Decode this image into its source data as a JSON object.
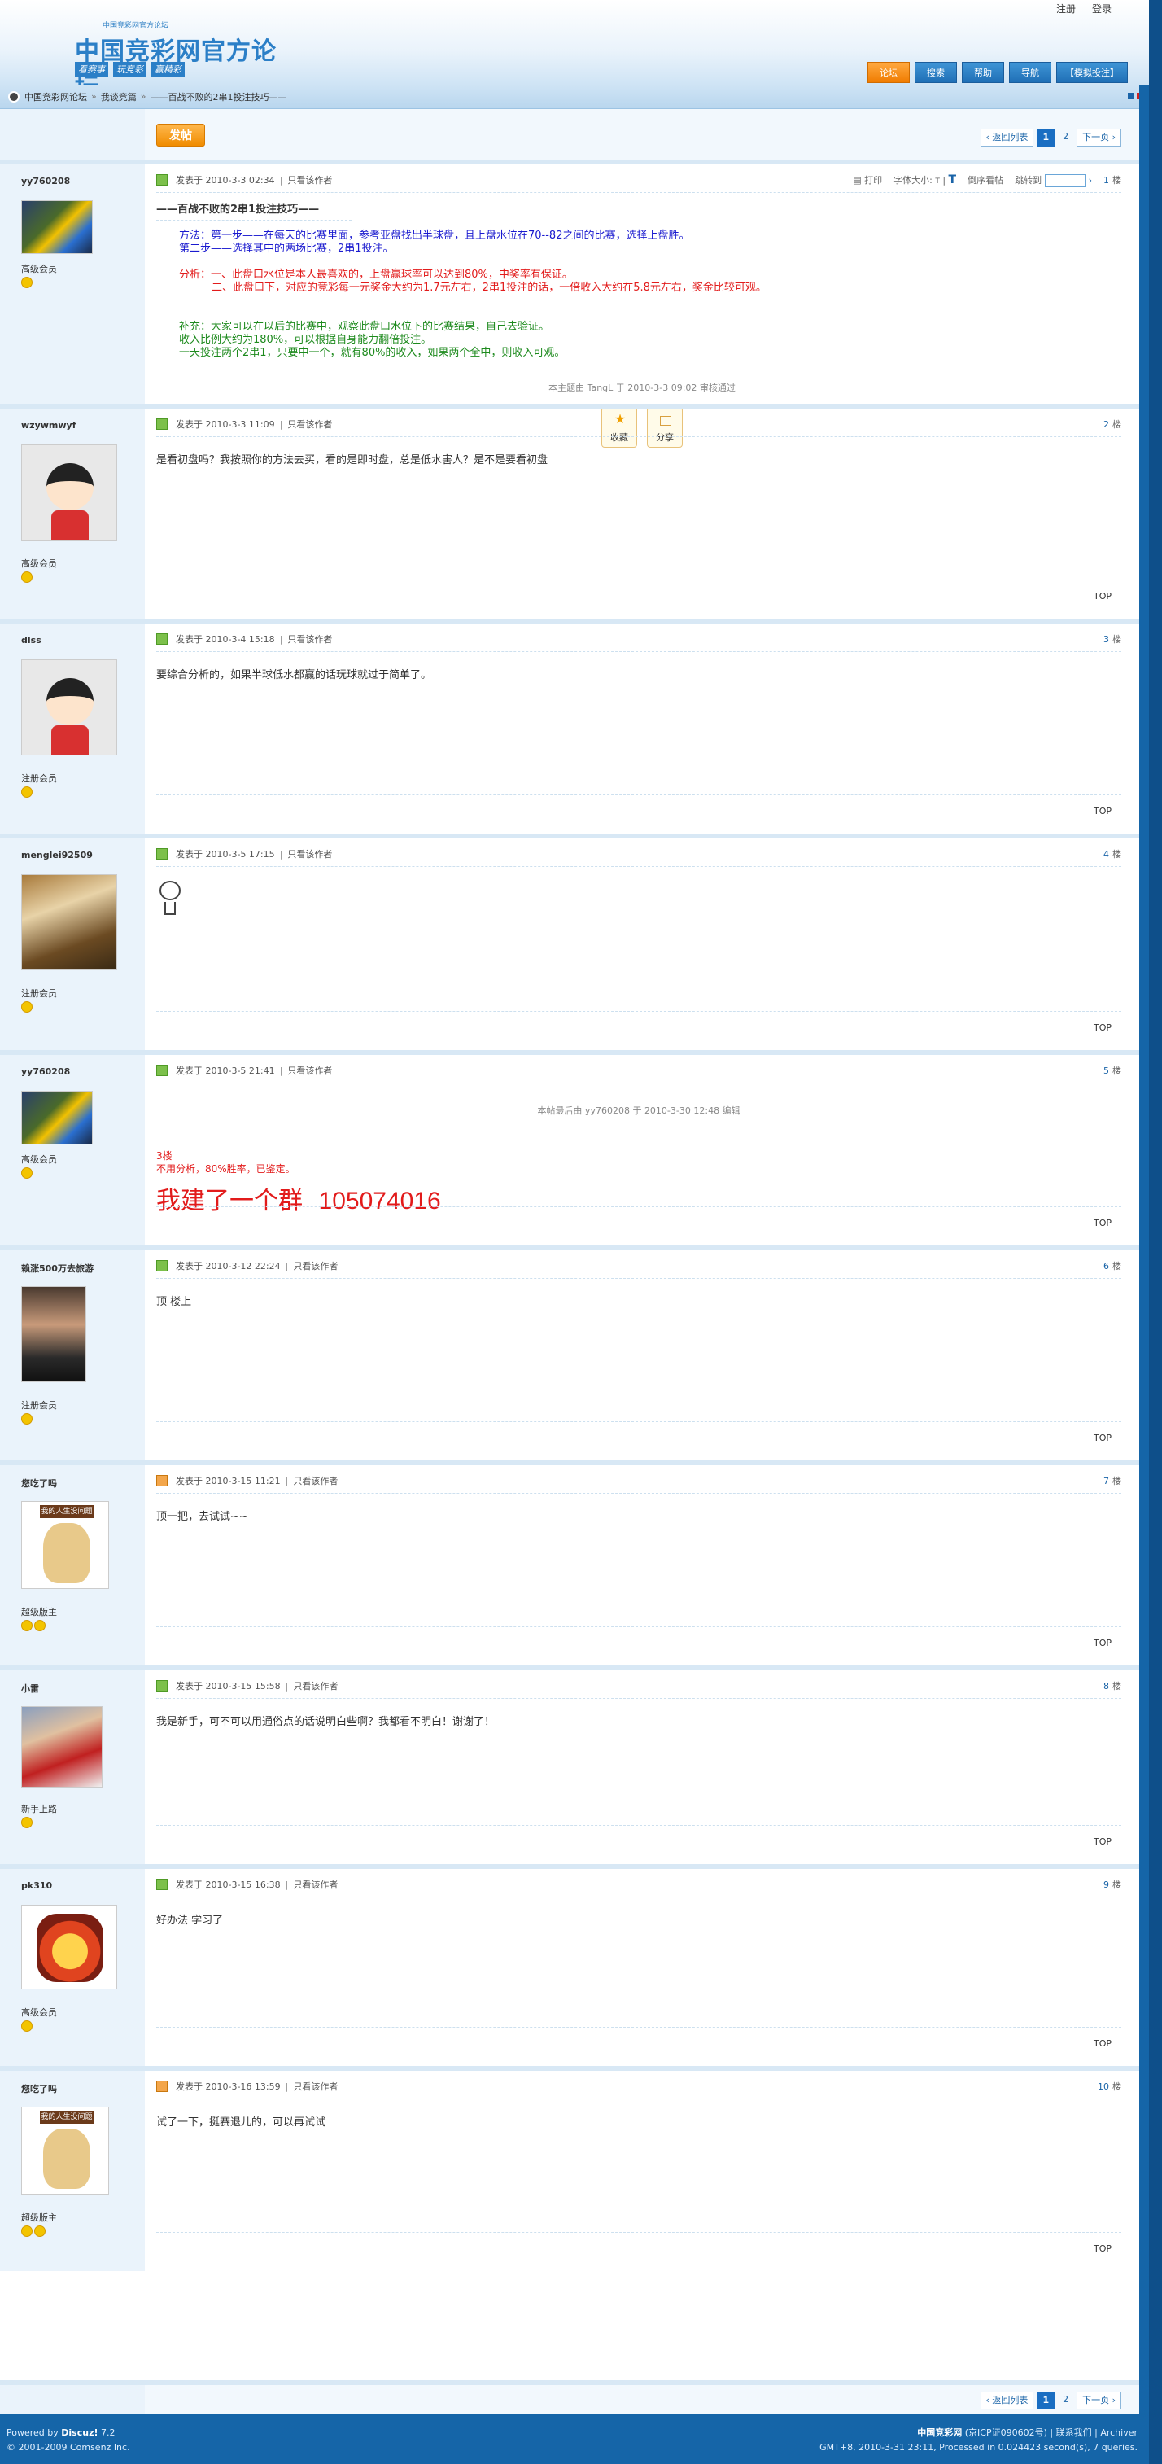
{
  "header": {
    "logo_sub": "中国竞彩网官方论坛",
    "logo_title": "中国竞彩网官方论坛",
    "logo_tags": [
      "看赛事",
      "玩竞彩",
      "赢精彩"
    ],
    "top_links": [
      "注册",
      "登录"
    ],
    "nav": [
      "论坛",
      "搜索",
      "帮助",
      "导航",
      "【模拟投注】"
    ]
  },
  "breadcrumb": [
    "中国竞彩网论坛",
    "我谈竞篇",
    "——百战不败的2串1投注技巧——"
  ],
  "toolbar": {
    "post_button": "发帖",
    "back_list": "‹ 返回列表",
    "page1": "1",
    "page2": "2",
    "next": "下一页 ›"
  },
  "post_tools": {
    "print": "打印",
    "font_size": "字体大小:",
    "font_t_small": "T",
    "font_t_big": "T",
    "reverse": "倒序看帖",
    "jump": "跳转到"
  },
  "posts": [
    {
      "user": "yy760208",
      "rank": "高级会员",
      "stars": 1,
      "time": "发表于 2010-3-3 02:34",
      "author_only": "只看该作者",
      "floor": "1",
      "floor_suffix": "楼",
      "title": "——百战不败的2串1投注技巧——",
      "lines_blue": [
        "方法：第一步——在每天的比赛里面，参考亚盘找出半球盘，且上盘水位在70--82之间的比赛，选择上盘胜。",
        "第二步——选择其中的两场比赛，2串1投注。"
      ],
      "lines_red": [
        "分析：一、此盘口水位是本人最喜欢的，上盘赢球率可以达到80%，中奖率有保证。",
        "二、此盘口下，对应的竞彩每一元奖金大约为1.7元左右，2串1投注的话，一倍收入大约在5.8元左右，奖金比较可观。"
      ],
      "lines_green": [
        "补充：大家可以在以后的比赛中，观察此盘口水位下的比赛结果，自己去验证。",
        "收入比例大约为180%，可以根据自身能力翻倍投注。",
        "一天投注两个2串1，只要中一个，就有80%的收入，如果两个全中，则收入可观。"
      ],
      "edit_note": "本主题由 TangL 于 2010-3-3 09:02 审核通过",
      "actions": [
        "收藏",
        "分享"
      ]
    },
    {
      "user": "wzywmwyf",
      "rank": "高级会员",
      "stars": 1,
      "time": "发表于 2010-3-3 11:09",
      "author_only": "只看该作者",
      "floor": "2",
      "floor_suffix": "楼",
      "text": "是看初盘吗？我按照你的方法去买，看的是即时盘，总是低水害人？是不是要看初盘",
      "top": "TOP"
    },
    {
      "user": "dlss",
      "rank": "注册会员",
      "stars": 1,
      "time": "发表于 2010-3-4 15:18",
      "author_only": "只看该作者",
      "floor": "3",
      "floor_suffix": "楼",
      "text": "要综合分析的，如果半球低水都赢的话玩球就过于简单了。",
      "top": "TOP"
    },
    {
      "user": "menglei92509",
      "rank": "注册会员",
      "stars": 1,
      "time": "发表于 2010-3-5 17:15",
      "author_only": "只看该作者",
      "floor": "4",
      "floor_suffix": "楼",
      "text": "",
      "top": "TOP"
    },
    {
      "user": "yy760208",
      "rank": "高级会员",
      "stars": 1,
      "time": "发表于 2010-3-5 21:41",
      "author_only": "只看该作者",
      "floor": "5",
      "floor_suffix": "楼",
      "edit_note": "本帖最后由 yy760208 于 2010-3-30 12:48 编辑",
      "line1": "3楼",
      "line2": "不用分析，80%胜率，已鉴定。",
      "big_text": "我建了一个群",
      "big_num": "105074016",
      "top": "TOP"
    },
    {
      "user": "赖涨500万去旅游",
      "rank": "注册会员",
      "stars": 1,
      "time": "发表于 2010-3-12 22:24",
      "author_only": "只看该作者",
      "floor": "6",
      "floor_suffix": "楼",
      "text": "顶 楼上",
      "top": "TOP"
    },
    {
      "user": "您吃了吗",
      "rank": "超级版主",
      "stars": 2,
      "time": "发表于 2010-3-15 11:21",
      "author_only": "只看该作者",
      "floor": "7",
      "floor_suffix": "楼",
      "text": "顶一把，去试试~~",
      "top": "TOP",
      "avatar_label": "我的人生没问题"
    },
    {
      "user": "小雷",
      "rank": "新手上路",
      "stars": 1,
      "time": "发表于 2010-3-15 15:58",
      "author_only": "只看该作者",
      "floor": "8",
      "floor_suffix": "楼",
      "text": "我是新手，可不可以用通俗点的话说明白些啊？我都看不明白！谢谢了！",
      "top": "TOP"
    },
    {
      "user": "pk310",
      "rank": "高级会员",
      "stars": 1,
      "time": "发表于 2010-3-15 16:38",
      "author_only": "只看该作者",
      "floor": "9",
      "floor_suffix": "楼",
      "text": "好办法 学习了",
      "top": "TOP"
    },
    {
      "user": "您吃了吗",
      "rank": "超级版主",
      "stars": 2,
      "time": "发表于 2010-3-16 13:59",
      "author_only": "只看该作者",
      "floor": "10",
      "floor_suffix": "楼",
      "text": "试了一下，挺赛退儿的，可以再试试",
      "top": "TOP",
      "avatar_label": "我的人生没问题"
    }
  ],
  "footer": {
    "powered": "Powered by",
    "discuz": "Discuz!",
    "version": "7.2",
    "copyright": "© 2001-2009 Comsenz Inc.",
    "site": "中国竞彩网",
    "icp": "(京ICP证090602号)",
    "contact": "联系我们",
    "archiver": "Archiver",
    "gmt": "GMT+8, 2010-3-31 23:11, Processed in 0.024423 second(s), 7 queries."
  }
}
